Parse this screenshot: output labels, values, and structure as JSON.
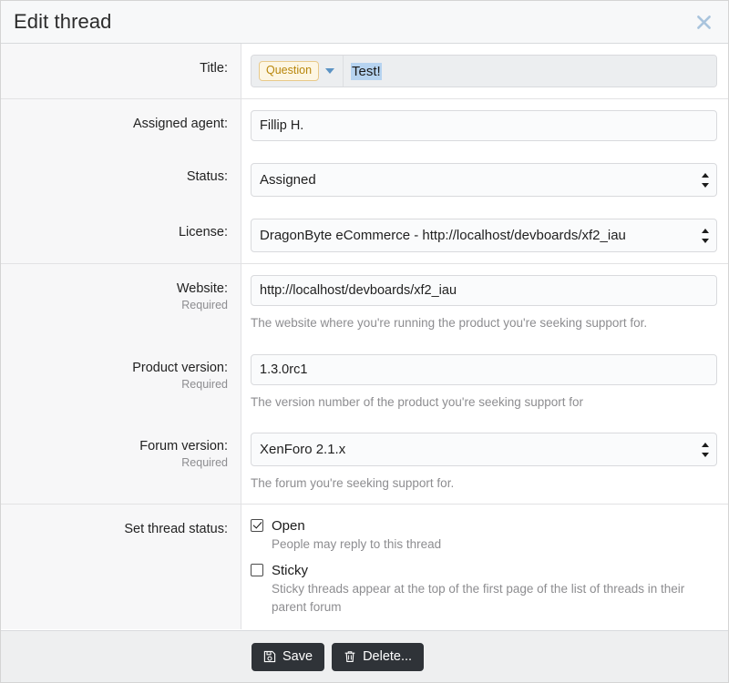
{
  "dialog": {
    "title": "Edit thread",
    "close_icon": "close-x-icon"
  },
  "fields": {
    "title": {
      "label": "Title:",
      "prefix": "Question",
      "value": "Test!",
      "caret_icon": "chevron-down-icon"
    },
    "assigned_agent": {
      "label": "Assigned agent:",
      "value": "Fillip H."
    },
    "status": {
      "label": "Status:",
      "value": "Assigned"
    },
    "license": {
      "label": "License:",
      "value": "DragonByte eCommerce - http://localhost/devboards/xf2_iau"
    },
    "website": {
      "label": "Website:",
      "required": "Required",
      "value": "http://localhost/devboards/xf2_iau",
      "hint": "The website where you're running the product you're seeking support for."
    },
    "product_version": {
      "label": "Product version:",
      "required": "Required",
      "value": "1.3.0rc1",
      "hint": "The version number of the product you're seeking support for"
    },
    "forum_version": {
      "label": "Forum version:",
      "required": "Required",
      "value": "XenForo 2.1.x",
      "hint": "The forum you're seeking support for."
    },
    "thread_status": {
      "label": "Set thread status:",
      "options": [
        {
          "label": "Open",
          "desc": "People may reply to this thread",
          "checked": true
        },
        {
          "label": "Sticky",
          "desc": "Sticky threads appear at the top of the first page of the list of threads in their parent forum",
          "checked": false
        }
      ]
    }
  },
  "footer": {
    "save_label": "Save",
    "save_icon": "floppy-disk-icon",
    "delete_label": "Delete...",
    "delete_icon": "trash-can-icon"
  },
  "colors": {
    "header_bg": "#f7f8f9",
    "label_bg": "#f7f7f8",
    "button_bg": "#2f3338",
    "prefix_text": "#b8860b",
    "prefix_bg": "#fdf6e3",
    "selection_bg": "#b6d3f0",
    "close_icon": "#a9c4dd",
    "hint_text": "#8d8d90"
  }
}
